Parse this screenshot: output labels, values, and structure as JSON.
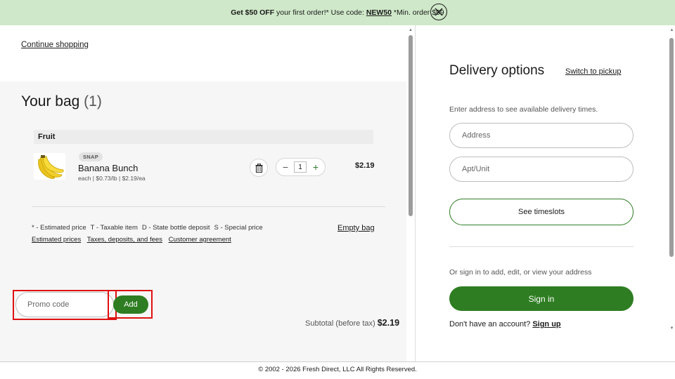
{
  "banner": {
    "strong1": "Get $50 OFF",
    "text1": " your first order!* Use code: ",
    "code": "NEW50",
    "text2": " *Min. order $99"
  },
  "cart": {
    "continue_label": "Continue shopping",
    "title": "Your bag",
    "count": "(1)",
    "category": "Fruit",
    "item": {
      "badge": "SNAP",
      "name": "Banana Bunch",
      "meta_each": "each",
      "meta_lb": "$0.73/lb",
      "meta_ea": "$2.19/ea",
      "quantity": "1",
      "price": "$2.19"
    },
    "legend": [
      "* - Estimated price",
      "T - Taxable item",
      "D - State bottle deposit",
      "S - Special price"
    ],
    "links": [
      "Estimated prices",
      "Taxes, deposits, and fees",
      "Customer agreement"
    ],
    "empty_bag_label": "Empty bag",
    "promo_placeholder": "Promo code",
    "add_label": "Add",
    "subtotal_label": "Subtotal (before tax)",
    "subtotal_value": "$2.19"
  },
  "delivery": {
    "title": "Delivery options",
    "switch_label": "Switch to pickup",
    "hint": "Enter address to see available delivery times.",
    "address_placeholder": "Address",
    "apt_placeholder": "Apt/Unit",
    "timeslots_label": "See timeslots",
    "signin_hint": "Or sign in to add, edit, or view your address",
    "signin_label": "Sign in",
    "signup_prompt": "Don't have an account?",
    "signup_label": "Sign up"
  },
  "footer": {
    "text": "© 2002 - 2026 Fresh Direct, LLC All Rights Reserved."
  },
  "colors": {
    "brand_green": "#2e7d22",
    "banner_bg": "#cfe8c9",
    "highlight_red": "#e01010"
  },
  "icons": {
    "banner_close": "close-icon",
    "trash": "trash-icon"
  }
}
